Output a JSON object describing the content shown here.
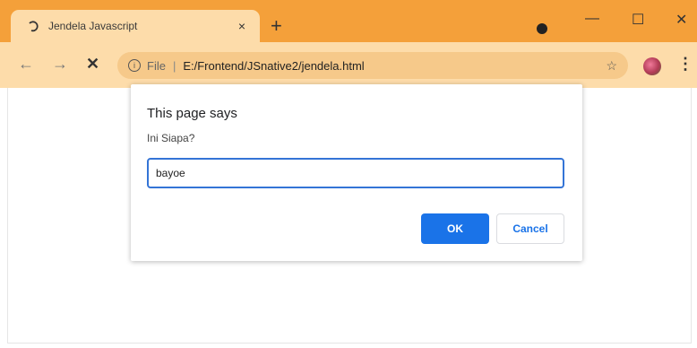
{
  "tab": {
    "title": "Jendela Javascript",
    "close_glyph": "×"
  },
  "newtab_glyph": "+",
  "window": {
    "minimize": "—",
    "maximize": "☐",
    "close": "✕"
  },
  "toolbar": {
    "back": "←",
    "forward": "→",
    "stop": "✕",
    "scheme": "File",
    "separator": "|",
    "url": "E:/Frontend/JSnative2/jendela.html",
    "star": "☆",
    "menu": "⋮"
  },
  "dialog": {
    "heading": "This page says",
    "message": "Ini Siapa?",
    "input_value": "bayoe",
    "ok_label": "OK",
    "cancel_label": "Cancel"
  },
  "colors": {
    "titlebar": "#f4a03a",
    "toolbar": "#fddcaa",
    "omnibox": "#f6c98a",
    "accent": "#1a73e8"
  }
}
